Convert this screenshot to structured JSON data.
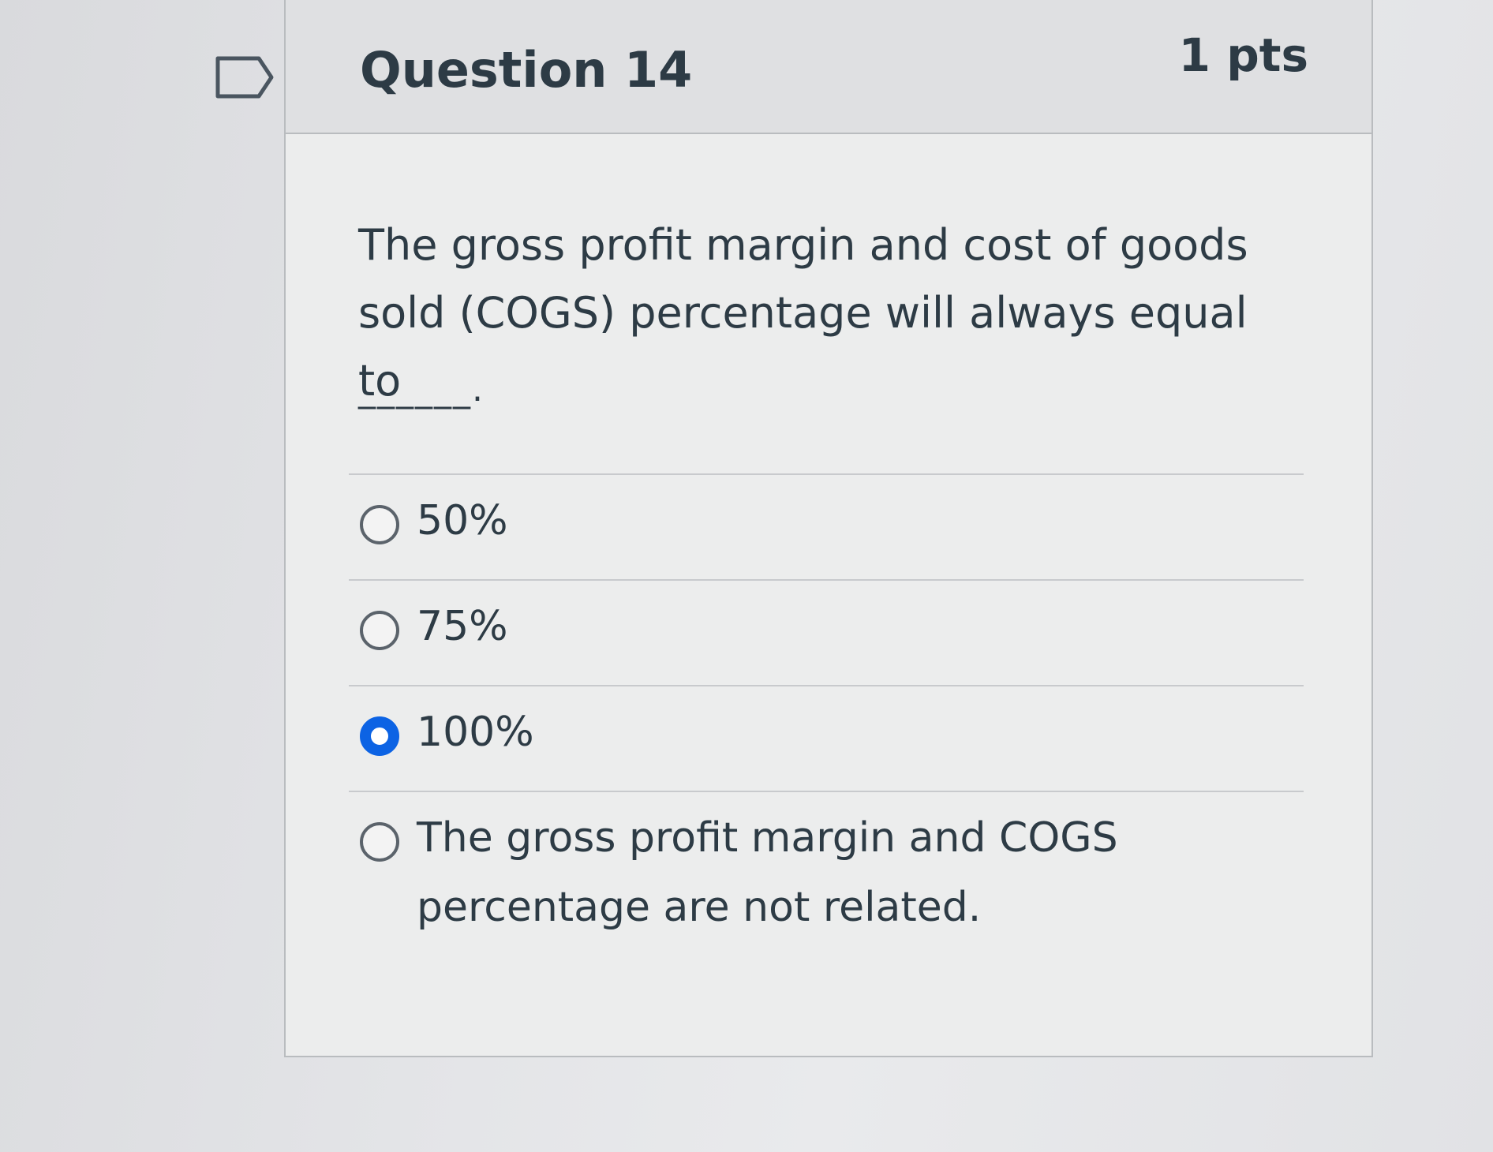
{
  "question": {
    "title": "Question 14",
    "points": "1 pts",
    "text": "The gross profit margin and cost of goods sold (COGS) percentage will always equal to",
    "blank": "______."
  },
  "flag_icon": "bookmark-flag-icon",
  "answers": [
    {
      "label": "50%",
      "selected": false
    },
    {
      "label": "75%",
      "selected": false
    },
    {
      "label": "100%",
      "selected": true
    },
    {
      "label": "The gross profit margin and COGS percentage are not related.",
      "selected": false
    }
  ],
  "colors": {
    "selected_radio": "#0c63e4",
    "text": "#2d3b45"
  }
}
